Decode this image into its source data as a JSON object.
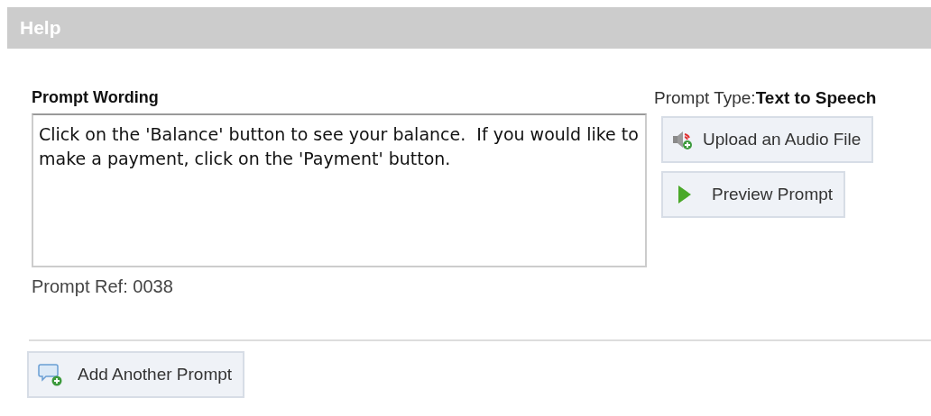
{
  "header": {
    "title": "Help"
  },
  "prompt_wording": {
    "label": "Prompt Wording",
    "value": "Click on the 'Balance' button to see your balance.  If you would like to make a payment, click on the 'Payment' button.",
    "ref_label": "Prompt Ref: 0038"
  },
  "prompt_type": {
    "label": "Prompt Type:",
    "value": "Text to Speech"
  },
  "buttons": [
    {
      "kind": "upload",
      "label": "Upload an Audio File"
    },
    {
      "kind": "preview",
      "label": "Preview Prompt"
    }
  ],
  "footer_button": {
    "kind": "add",
    "label": "Add Another Prompt"
  }
}
